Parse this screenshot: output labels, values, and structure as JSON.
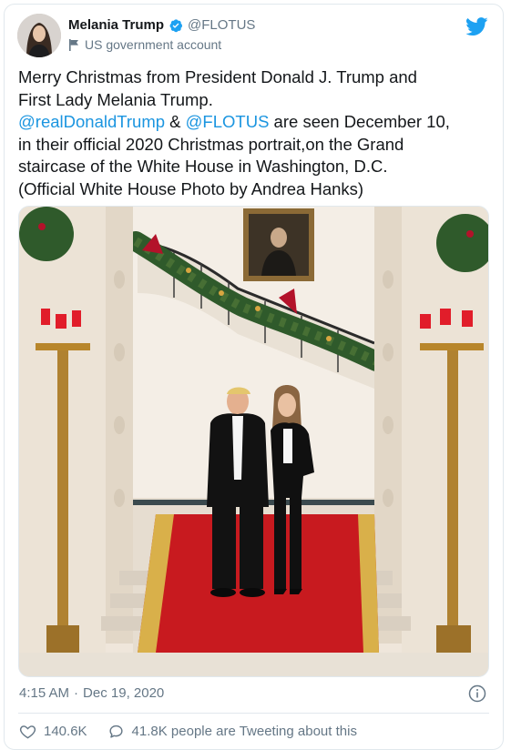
{
  "author": {
    "display_name": "Melania Trump",
    "handle": "@FLOTUS",
    "account_label": "US government account",
    "verified": true
  },
  "tweet": {
    "lines": [
      {
        "parts": [
          {
            "text": "Merry Christmas from President Donald J. Trump and"
          }
        ]
      },
      {
        "parts": [
          {
            "text": "First Lady Melania Trump."
          }
        ]
      },
      {
        "parts": [
          {
            "text": "@realDonaldTrump",
            "mention": true
          },
          {
            "text": " & "
          },
          {
            "text": "@FLOTUS",
            "mention": true
          },
          {
            "text": " are seen December 10,"
          }
        ]
      },
      {
        "parts": [
          {
            "text": "in their official 2020 Christmas portrait,on the Grand"
          }
        ]
      },
      {
        "parts": [
          {
            "text": "staircase of the White House in Washington, D.C."
          }
        ]
      },
      {
        "parts": [
          {
            "text": "(Official White House Photo by Andrea Hanks)"
          }
        ]
      }
    ]
  },
  "meta": {
    "time": "4:15 AM",
    "separator": "·",
    "date": "Dec 19, 2020"
  },
  "actions": {
    "likes": "140.6K",
    "replies_label": "41.8K people are Tweeting about this"
  },
  "icons": {
    "verified": "verified-badge-icon",
    "flag": "flag-icon",
    "brand": "twitter-bird-icon",
    "info": "info-icon",
    "like": "heart-icon",
    "reply": "speech-bubble-icon"
  },
  "colors": {
    "accent": "#1da1f2",
    "link": "#1b95e0",
    "secondary_text": "#657786",
    "border": "#e1e8ed"
  }
}
